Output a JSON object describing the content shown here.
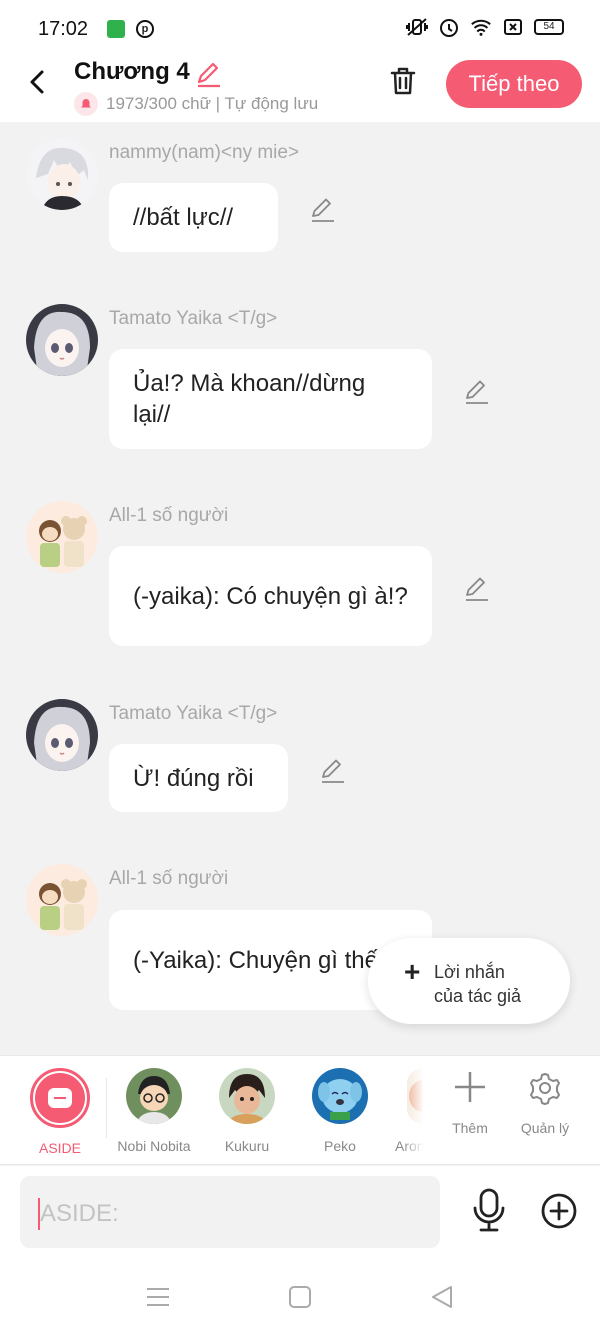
{
  "status_bar": {
    "time": "17:02",
    "battery": "54"
  },
  "header": {
    "title": "Chương 4",
    "subtitle": "1973/300 chữ | Tự động lưu",
    "next_label": "Tiếp theo",
    "accent_color": "#f55b73"
  },
  "messages": [
    {
      "sender": "nammy(nam)<ny mie>",
      "text": "//bất lực//"
    },
    {
      "sender": "Tamato Yaika <T/g>",
      "text": "Ủa!? Mà khoan//dừng lại//"
    },
    {
      "sender": "All-1 số người",
      "text": "(-yaika): Có chuyện gì à!?"
    },
    {
      "sender": "Tamato Yaika <T/g>",
      "text": "Ừ! đúng rồi"
    },
    {
      "sender": "All-1 số người",
      "text": "(-Yaika): Chuyện gì thế?"
    }
  ],
  "author_note": {
    "line1": "Lời nhắn",
    "line2": "của tác giả"
  },
  "characters": [
    {
      "label": "ASIDE"
    },
    {
      "label": "Nobi Nobita"
    },
    {
      "label": "Kukuru"
    },
    {
      "label": "Peko"
    },
    {
      "label": "Aron"
    }
  ],
  "actions": {
    "add_label": "Thêm",
    "manage_label": "Quản lý"
  },
  "input": {
    "placeholder": "ASIDE:"
  }
}
